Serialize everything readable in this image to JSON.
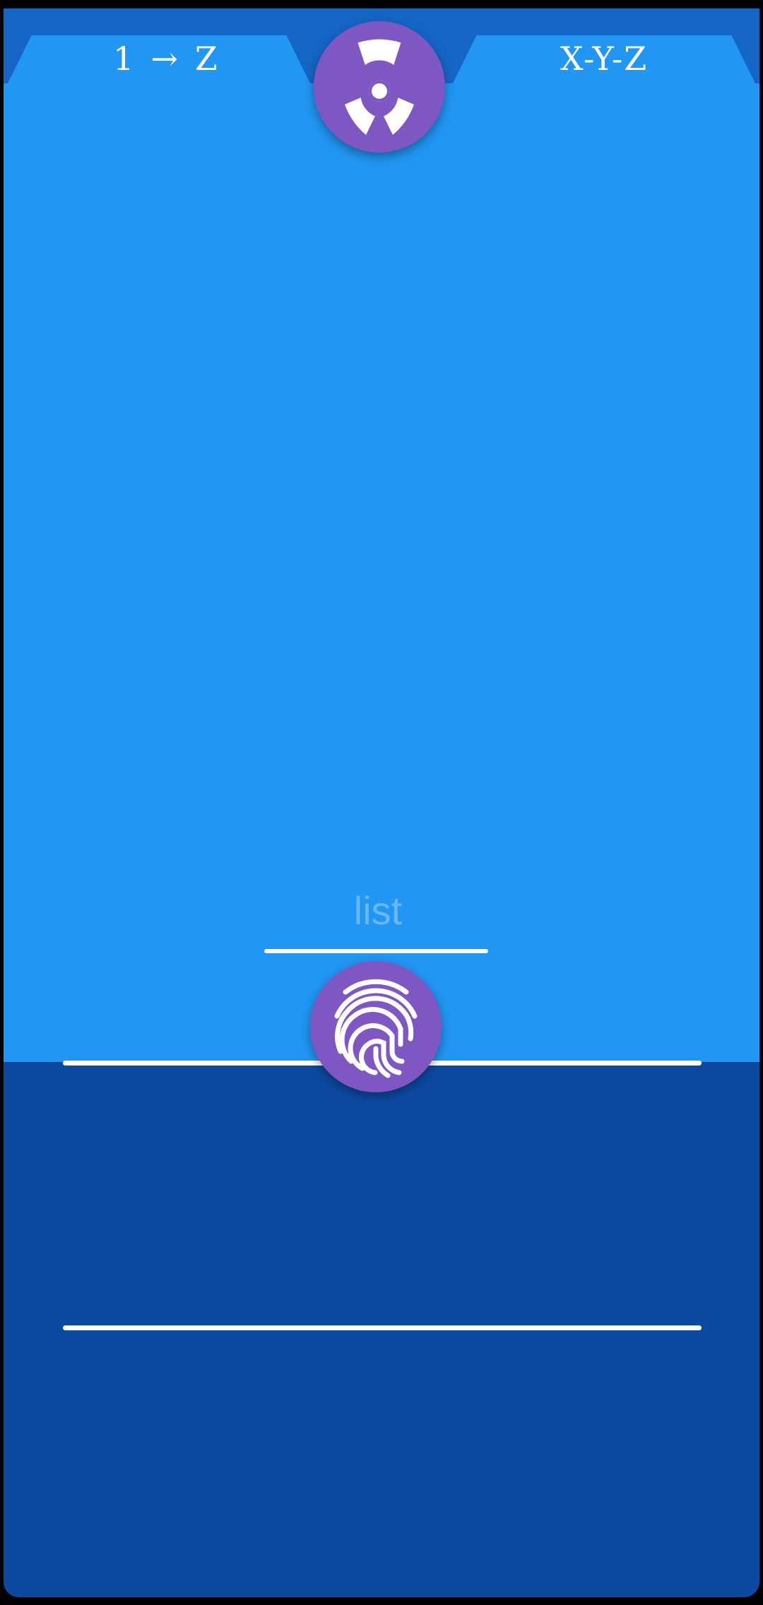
{
  "tabs": {
    "left": {
      "from": "1",
      "arrow": "→",
      "to": "Z"
    },
    "right": {
      "label": "X-Y-Z"
    }
  },
  "fab_top": {
    "icon": "radioactive-icon"
  },
  "fab_bottom": {
    "icon": "fingerprint-icon"
  },
  "list_field": {
    "placeholder": "list"
  },
  "colors": {
    "top_bar": "#1565c6",
    "tab": "#2196f3",
    "upper_panel": "#2196f3",
    "lower_panel": "#0c4aa2",
    "fab": "#7e57c2",
    "placeholder_text": "#6ab7f5",
    "rule": "#ffffff"
  }
}
